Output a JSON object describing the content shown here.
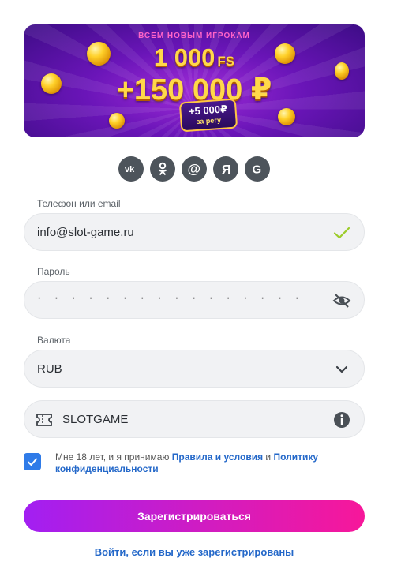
{
  "banner": {
    "top_line": "ВСЕМ НОВЫМ ИГРОКАМ",
    "free_spins": "1 000",
    "free_spins_suffix": "FS",
    "bonus": "+150 000 ₽",
    "badge_value": "+5 000₽",
    "badge_sub": "за регу"
  },
  "social": {
    "items": [
      {
        "label": "vk",
        "icon": "vk-icon"
      },
      {
        "label": "ок",
        "icon": "odnoklassniki-icon"
      },
      {
        "label": "@",
        "icon": "mail-icon"
      },
      {
        "label": "Я",
        "icon": "yandex-icon"
      },
      {
        "label": "G",
        "icon": "google-icon"
      }
    ]
  },
  "form": {
    "contact_label": "Телефон или email",
    "contact_value": "info@slot-game.ru",
    "password_label": "Пароль",
    "password_value": "· · · · · · · · · · · · · · · ·",
    "currency_label": "Валюта",
    "currency_value": "RUB",
    "promo_value": "SLOTGAME"
  },
  "agreement": {
    "text_start": "Мне 18 лет, и я принимаю ",
    "terms_link": "Правила и условия",
    "and": " и ",
    "privacy_link": "Политику конфиденциальности"
  },
  "actions": {
    "register": "Зарегистрироваться",
    "login": "Войти, если вы уже зарегистрированы"
  },
  "colors": {
    "accent_blue": "#2f7be8",
    "link_blue": "#2468c9",
    "button_gradient_start": "#a21ff2",
    "button_gradient_end": "#f7179a",
    "valid_check": "#9ccc2a"
  }
}
